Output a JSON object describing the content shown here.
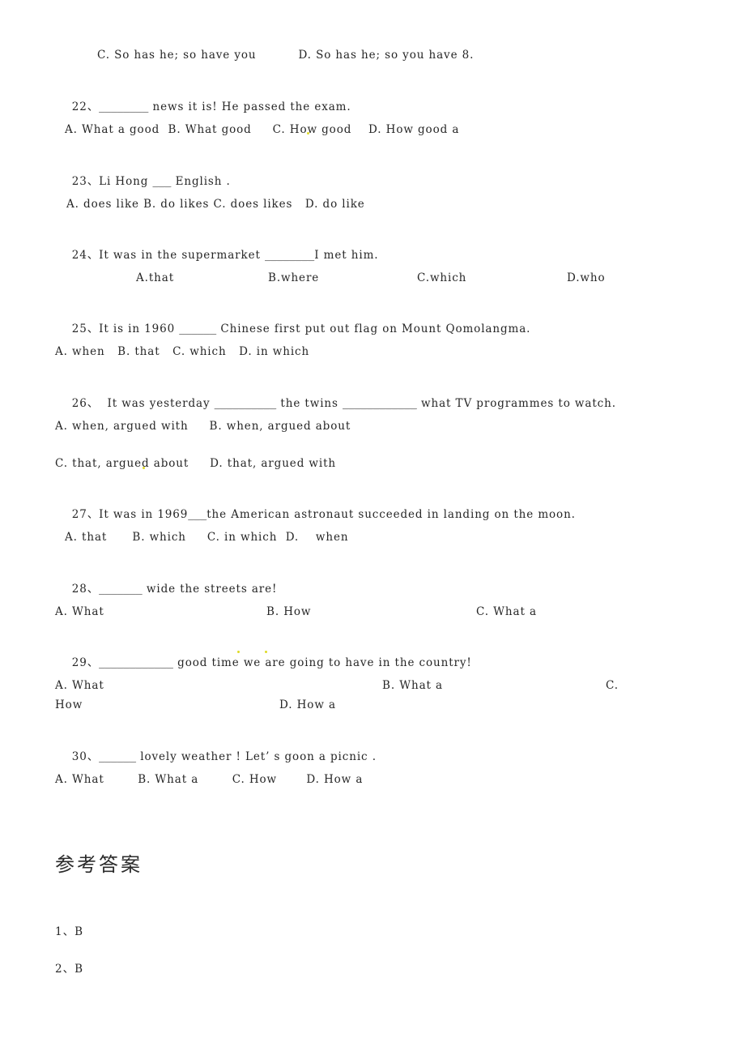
{
  "document": {
    "type": "english-grammar-worksheet",
    "background_color": "#ffffff",
    "text_color": "#262626",
    "blank_color": "#8a8a8a"
  },
  "questions": [
    {
      "id": "q21-options-tail",
      "number": "",
      "stem": "",
      "options_line": "C. So has he; so have you          D. So has he; so you have 8."
    },
    {
      "id": "q22",
      "number": "22、",
      "stem_before_blank": "22、",
      "blank": "________",
      "stem_after_blank": " news it is! He passed the exam.",
      "options_line": "A. What a good  B. What good     C. How good    D. How good a"
    },
    {
      "id": "q23",
      "number": "23、",
      "stem_before_blank": "23、Li Hong ",
      "blank": "___",
      "stem_after_blank": " English .",
      "options_line": "A. does like B. do likes C. does likes   D. do like"
    },
    {
      "id": "q24",
      "number": "24、",
      "stem_before_blank": "24、It was in the supermarket ",
      "blank": "________",
      "stem_after_blank": "I met him.",
      "option_a": "A.that",
      "option_b": "B.where",
      "option_c": "C.which",
      "option_d": "D.who"
    },
    {
      "id": "q25",
      "number": "25、",
      "stem_before_blank": "25、It is in 1960 ",
      "blank": "______",
      "stem_after_blank": " Chinese first put out flag on Mount Qomolangma.",
      "options_line": "A. when   B. that   C. which   D. in which"
    },
    {
      "id": "q26",
      "number": "26、",
      "stem_part1": "26、  It was yesterday ",
      "blank1": "__________",
      "stem_part2": " the twins ",
      "blank2": "____________",
      "stem_part3": " what TV programmes to watch.",
      "options_line1": "A. when, argued with     B. when, argued about",
      "options_line2": "C. that, argued about     D. that, argued with"
    },
    {
      "id": "q27",
      "number": "27、",
      "stem_before_blank": "27、It was in 1969",
      "blank": "___",
      "stem_after_blank": "the American astronaut succeeded in landing on the moon.",
      "options_line": "A. that      B. which     C. in which  D.    when"
    },
    {
      "id": "q28",
      "number": "28、",
      "stem_before_blank": "28、",
      "blank": "_______",
      "stem_after_blank": " wide the streets are!",
      "option_a": "A. What",
      "option_b": "B. How",
      "option_c": "C. What a"
    },
    {
      "id": "q29",
      "number": "29、",
      "stem_before_blank": "29、",
      "blank": "____________",
      "stem_after_blank": " good time we are going to have in the country!",
      "option_a": "A. What",
      "option_b": "B. What a",
      "option_c_prefix": "C.",
      "option_c_wrap": "How",
      "option_d": "D. How a"
    },
    {
      "id": "q30",
      "number": "30、",
      "stem_before_blank": "30、",
      "blank": "______",
      "stem_after_blank": " lovely weather ! Let’ s goon a picnic .",
      "options_line": "A. What        B. What a        C. How       D. How a"
    }
  ],
  "answers_section": {
    "heading": "参考答案",
    "items": [
      {
        "label": "1、B"
      },
      {
        "label": "2、B"
      }
    ]
  }
}
